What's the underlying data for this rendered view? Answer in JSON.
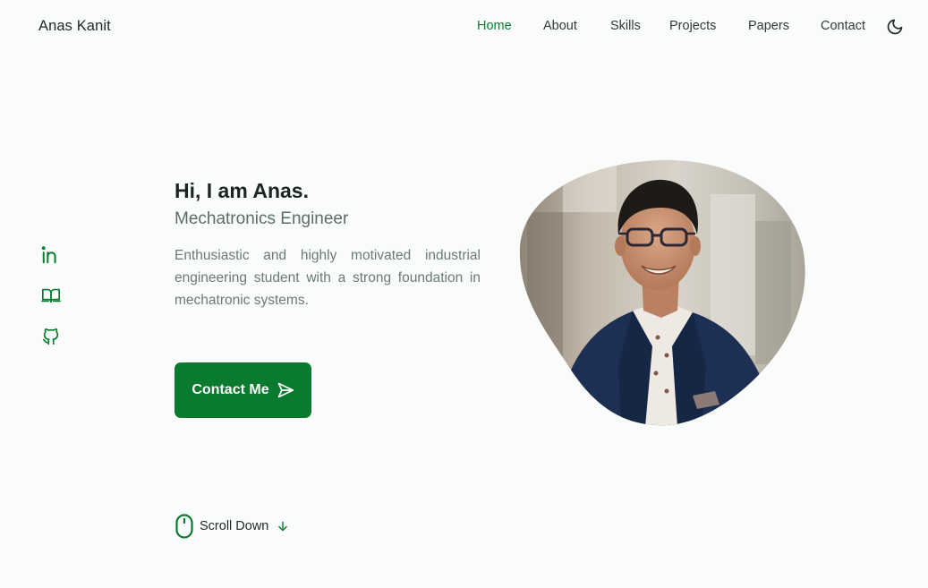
{
  "header": {
    "logo": "Anas Kanit",
    "nav": [
      {
        "label": "Home",
        "active": true
      },
      {
        "label": "About"
      },
      {
        "label": "Skills"
      },
      {
        "label": "Projects"
      },
      {
        "label": "Papers"
      },
      {
        "label": "Contact"
      }
    ],
    "theme_icon": "moon-icon"
  },
  "social": {
    "icons": [
      "linkedin-icon",
      "book-icon",
      "github-icon"
    ]
  },
  "hero": {
    "title": "Hi, I am Anas.",
    "subtitle": "Mechatronics Engineer",
    "description": "Enthusiastic and highly motivated industrial engineering student with a strong foundation in mechatronic systems.",
    "button_label": "Contact Me",
    "button_icon": "send-icon"
  },
  "scroll": {
    "label": "Scroll Down",
    "icons": [
      "mouse-icon",
      "arrow-down-icon"
    ]
  },
  "colors": {
    "accent": "#0a7a2f",
    "background": "#f9fcfb",
    "text": "#1f2a24",
    "muted": "#6b7b71"
  }
}
